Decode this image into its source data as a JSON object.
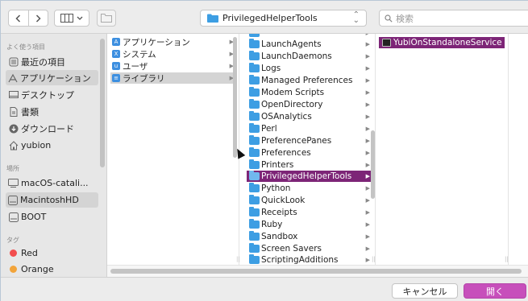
{
  "toolbar": {
    "back_icon": "chevron-left",
    "forward_icon": "chevron-right",
    "view_icon": "column-view",
    "new_folder_icon": "folder-add",
    "path_label": "PrivilegedHelperTools",
    "search_placeholder": "検索"
  },
  "sidebar": {
    "favorites_header": "よく使う項目",
    "favorites": [
      {
        "label": "最近の項目",
        "icon": "clock-icon"
      },
      {
        "label": "アプリケーション",
        "icon": "apps-icon",
        "selected": true
      },
      {
        "label": "デスクトップ",
        "icon": "desktop-icon"
      },
      {
        "label": "書類",
        "icon": "documents-icon"
      },
      {
        "label": "ダウンロード",
        "icon": "download-icon"
      },
      {
        "label": "yubion",
        "icon": "home-icon"
      }
    ],
    "locations_header": "場所",
    "locations": [
      {
        "label": "macOS-catali...",
        "icon": "disk-icon"
      },
      {
        "label": "MacintoshHD",
        "icon": "disk-icon",
        "selected": true
      },
      {
        "label": "BOOT",
        "icon": "disk-icon"
      }
    ],
    "tags_header": "タグ",
    "tags": [
      {
        "label": "Red",
        "color": "#f24d4d"
      },
      {
        "label": "Orange",
        "color": "#f2a43a"
      }
    ]
  },
  "column1": [
    {
      "label": "アプリケーション",
      "icon": "app-folder-icon"
    },
    {
      "label": "システム",
      "icon": "system-folder-icon"
    },
    {
      "label": "ユーザ",
      "icon": "users-folder-icon"
    },
    {
      "label": "ライブラリ",
      "icon": "library-folder-icon",
      "selected": true
    }
  ],
  "column2": [
    {
      "label": "LaunchAgents"
    },
    {
      "label": "LaunchDaemons"
    },
    {
      "label": "Logs"
    },
    {
      "label": "Managed Preferences"
    },
    {
      "label": "Modem Scripts"
    },
    {
      "label": "OpenDirectory"
    },
    {
      "label": "OSAnalytics"
    },
    {
      "label": "Perl"
    },
    {
      "label": "PreferencePanes"
    },
    {
      "label": "Preferences"
    },
    {
      "label": "Printers"
    },
    {
      "label": "PrivilegedHelperTools",
      "selected": true
    },
    {
      "label": "Python"
    },
    {
      "label": "QuickLook"
    },
    {
      "label": "Receipts"
    },
    {
      "label": "Ruby"
    },
    {
      "label": "Sandbox"
    },
    {
      "label": "Screen Savers"
    },
    {
      "label": "ScriptingAdditions"
    }
  ],
  "column3": [
    {
      "label": "YubiOnStandaloneService",
      "selected": true
    }
  ],
  "footer": {
    "cancel_label": "キャンセル",
    "open_label": "開く"
  },
  "colors": {
    "accent": "#7d2577",
    "open_button": "#c74fbb",
    "folder": "#3d9ee3"
  }
}
